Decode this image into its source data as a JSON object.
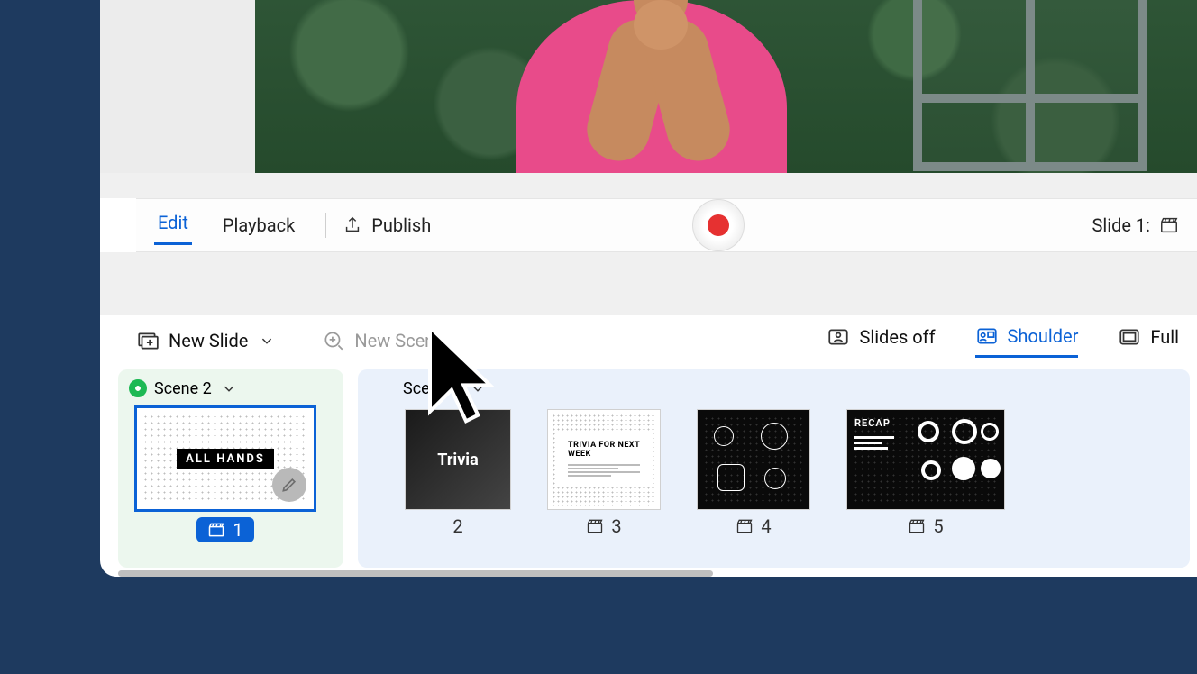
{
  "toolbar": {
    "edit": "Edit",
    "playback": "Playback",
    "publish": "Publish",
    "slide_label": "Slide 1:"
  },
  "actions": {
    "new_slide": "New Slide",
    "new_scene": "New Scene"
  },
  "view_modes": {
    "slides_off": "Slides off",
    "shoulder": "Shoulder",
    "full": "Full"
  },
  "scenes": {
    "scene2": {
      "title": "Scene 2"
    },
    "scene1": {
      "title": "Scene 1"
    }
  },
  "slides": {
    "s1": {
      "num": "1",
      "label": "ALL HANDS"
    },
    "s2": {
      "num": "2",
      "label": "Trivia"
    },
    "s3": {
      "num": "3",
      "title": "TRIVIA FOR NEXT WEEK"
    },
    "s4": {
      "num": "4"
    },
    "s5": {
      "num": "5",
      "title": "RECAP"
    }
  }
}
